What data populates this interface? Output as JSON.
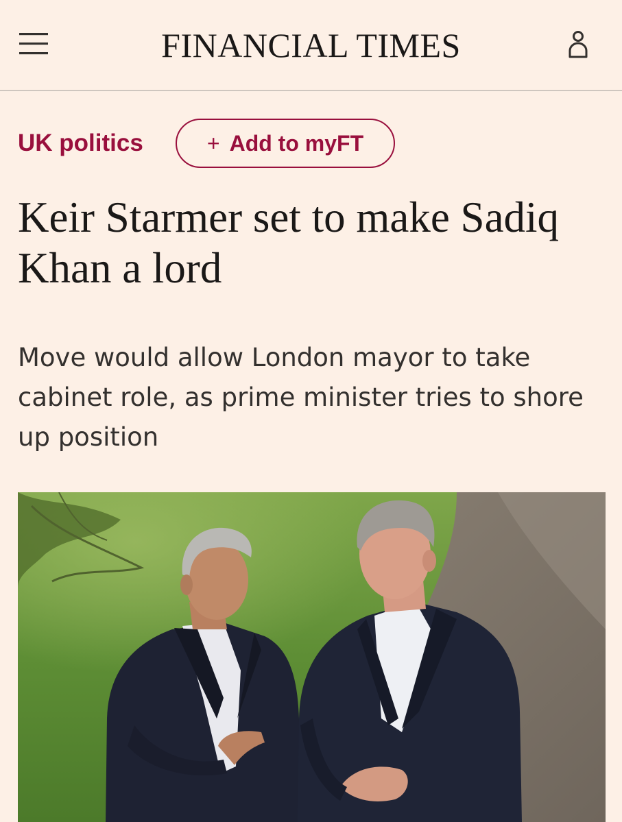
{
  "header": {
    "masthead": "FINANCIAL TIMES",
    "menu_icon": "hamburger-menu-icon",
    "account_icon": "user-icon"
  },
  "topic": {
    "label": "UK politics",
    "follow_button": {
      "plus": "+",
      "label": "Add to myFT"
    }
  },
  "article": {
    "headline": "Keir Starmer set to make Sadiq Khan a lord",
    "standfirst": "Move would allow London mayor to take cabinet role, as prime minister tries to shore up position",
    "image_alt": "Sadiq Khan and Keir Starmer talking outdoors on a path beside grass"
  },
  "colors": {
    "background": "#fdf0e6",
    "brand_claret": "#990f3d",
    "divider": "#cec6bf",
    "text": "#1a1817"
  }
}
